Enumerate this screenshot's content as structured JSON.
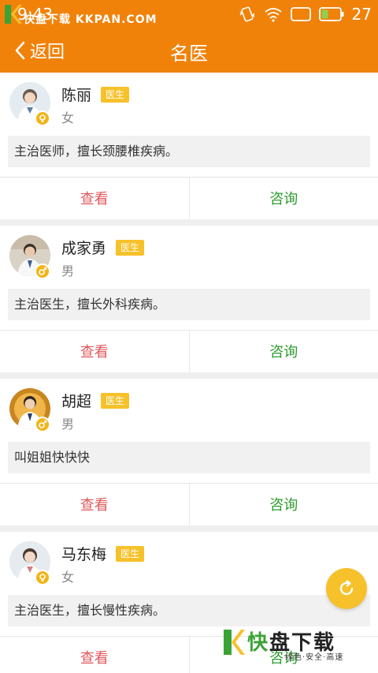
{
  "status_bar": {
    "time": "9:43",
    "watermark": "快盘下载 KKPAN.COM",
    "battery_level": "27"
  },
  "nav": {
    "back_label": "返回",
    "title": "名医"
  },
  "doctors": [
    {
      "name": "陈丽",
      "tag": "医生",
      "gender": "女",
      "description": "主治医师，擅长颈腰椎疾病。",
      "view_label": "查看",
      "consult_label": "咨询"
    },
    {
      "name": "成家勇",
      "tag": "医生",
      "gender": "男",
      "description": "主治医生，擅长外科疾病。",
      "view_label": "查看",
      "consult_label": "咨询"
    },
    {
      "name": "胡超",
      "tag": "医生",
      "gender": "男",
      "description": "叫姐姐快快快",
      "view_label": "查看",
      "consult_label": "咨询"
    },
    {
      "name": "马东梅",
      "tag": "医生",
      "gender": "女",
      "description": "主治医生，擅长慢性疾病。",
      "view_label": "查看",
      "consult_label": "咨询"
    }
  ],
  "watermark_bottom": {
    "brand_first": "快",
    "brand_rest": "盘下载",
    "slogan": "绿色·安全·高速"
  },
  "colors": {
    "primary": "#f0820a",
    "tag": "#f7c12a",
    "view": "#e0585c",
    "consult": "#2e9b2e",
    "fab": "#f6c12b"
  }
}
